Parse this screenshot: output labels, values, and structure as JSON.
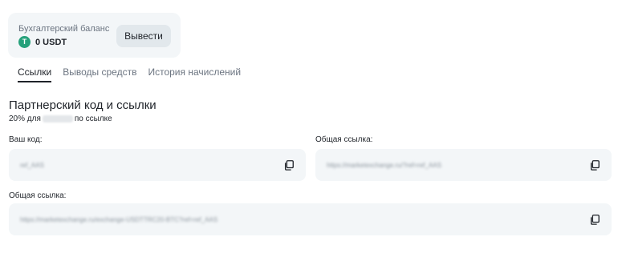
{
  "balance": {
    "label": "Бухгалтерский баланс",
    "currency_icon": "T",
    "amount": "0 USDT",
    "withdraw_label": "Вывести",
    "icon_color": "#26a17b"
  },
  "tabs": [
    {
      "label": "Ссылки",
      "active": true
    },
    {
      "label": "Выводы средств",
      "active": false
    },
    {
      "label": "История начислений",
      "active": false
    }
  ],
  "section": {
    "title": "Партнерский код и ссылки",
    "subtitle_prefix": "20% для",
    "subtitle_suffix": "по ссылке"
  },
  "fields": {
    "code": {
      "label": "Ваш код:",
      "value": "ref_AAS"
    },
    "link_short": {
      "label": "Общая ссылка:",
      "value": "https://marketexchange.ru/?ref=ref_AAS"
    },
    "link_full": {
      "label": "Общая ссылка:",
      "value": "https://marketexchange.ru/exchange-USDTTRC20-BTC?ref=ref_AAS"
    }
  }
}
